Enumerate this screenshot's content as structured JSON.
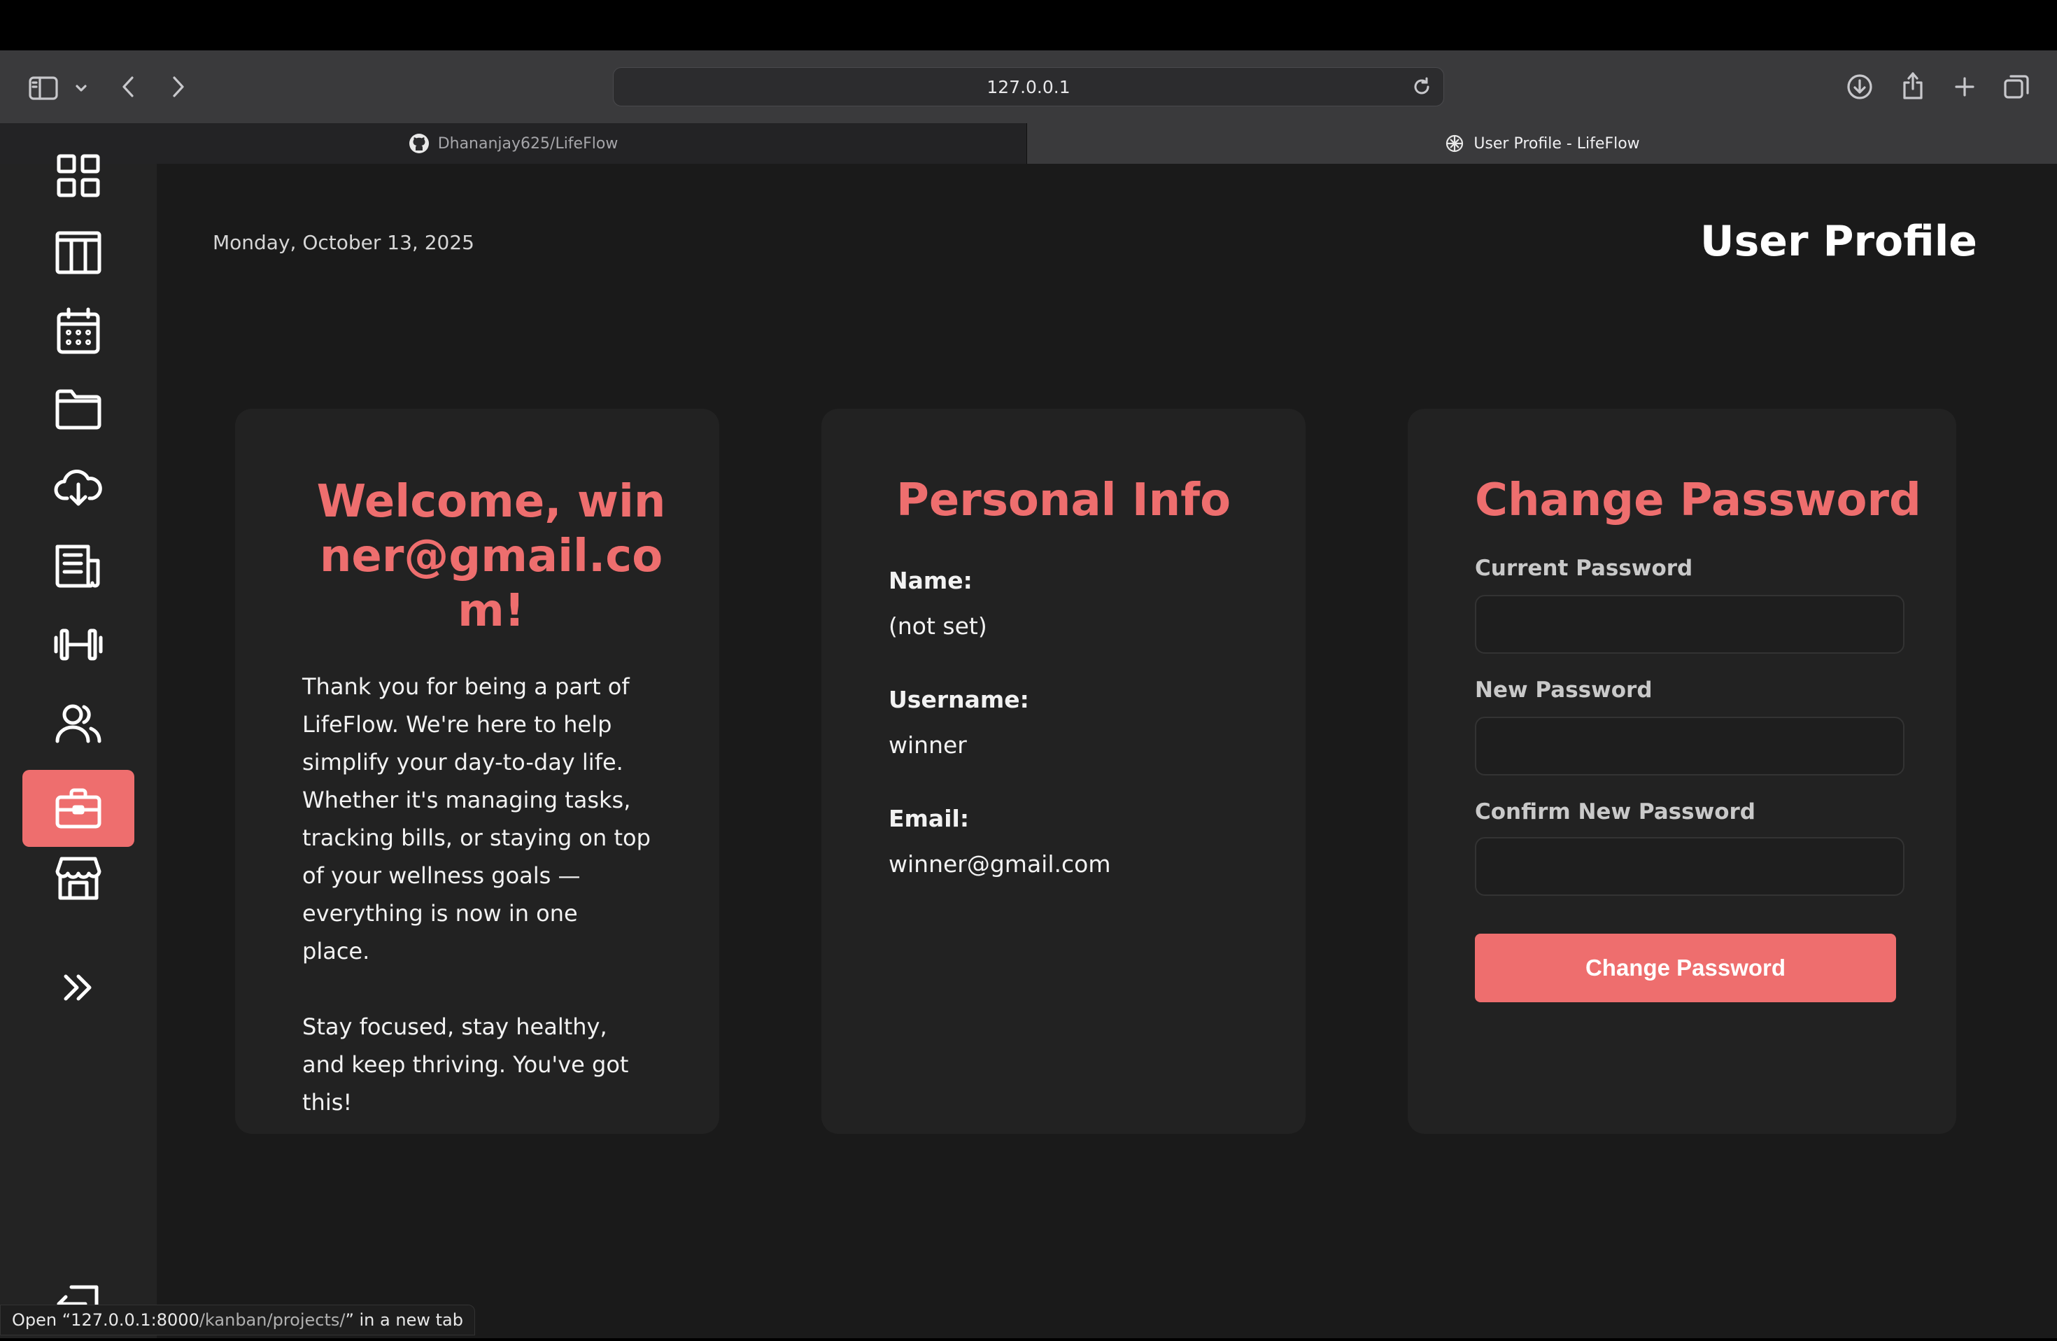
{
  "browser": {
    "url": "127.0.0.1",
    "tabs": [
      {
        "label": "Dhananjay625/LifeFlow",
        "icon": "github-icon",
        "active": false
      },
      {
        "label": "User Profile - LifeFlow",
        "icon": "openai-icon",
        "active": true
      }
    ],
    "status_prefix": "Open “",
    "status_host": "127.0.0.1:8000",
    "status_path": "/kanban/projects/",
    "status_suffix": "” in a new tab"
  },
  "sidebar": {
    "items": [
      {
        "name": "dashboard",
        "icon": "grid-icon",
        "active": false
      },
      {
        "name": "kanban",
        "icon": "columns-icon",
        "active": false
      },
      {
        "name": "calendar",
        "icon": "calendar-icon",
        "active": false
      },
      {
        "name": "folder",
        "icon": "folder-icon",
        "active": false
      },
      {
        "name": "cloud",
        "icon": "cloud-download-icon",
        "active": false
      },
      {
        "name": "documents",
        "icon": "newspaper-icon",
        "active": false
      },
      {
        "name": "fitness",
        "icon": "dumbbell-icon",
        "active": false
      },
      {
        "name": "users",
        "icon": "users-icon",
        "active": false
      },
      {
        "name": "profile",
        "icon": "briefcase-icon",
        "active": true
      },
      {
        "name": "store",
        "icon": "store-icon",
        "active": false
      },
      {
        "name": "expand",
        "icon": "chevrons-right-icon",
        "active": false
      },
      {
        "name": "logout",
        "icon": "logout-icon",
        "active": false
      }
    ]
  },
  "header": {
    "date": "Monday, October 13, 2025",
    "title": "User Profile"
  },
  "welcome": {
    "title": "Welcome, winner@gmail.com!",
    "paragraph1": "Thank you for being a part of LifeFlow. We're here to help simplify your day-to-day life. Whether it's managing tasks, tracking bills, or staying on top of your wellness goals — everything is now in one place.",
    "paragraph2": "Stay focused, stay healthy, and keep thriving. You've got this!"
  },
  "personal_info": {
    "title": "Personal Info",
    "name_label": "Name:",
    "name_value": "(not set)",
    "username_label": "Username:",
    "username_value": "winner",
    "email_label": "Email:",
    "email_value": "winner@gmail.com"
  },
  "change_password": {
    "title": "Change Password",
    "current_label": "Current Password",
    "current_value": "",
    "new_label": "New Password",
    "new_value": "",
    "confirm_label": "Confirm New Password",
    "confirm_value": "",
    "submit_label": "Change Password"
  },
  "colors": {
    "accent": "#ee6e6e",
    "background": "#1a1a1a",
    "card": "#222222",
    "sidebar": "#232323"
  }
}
